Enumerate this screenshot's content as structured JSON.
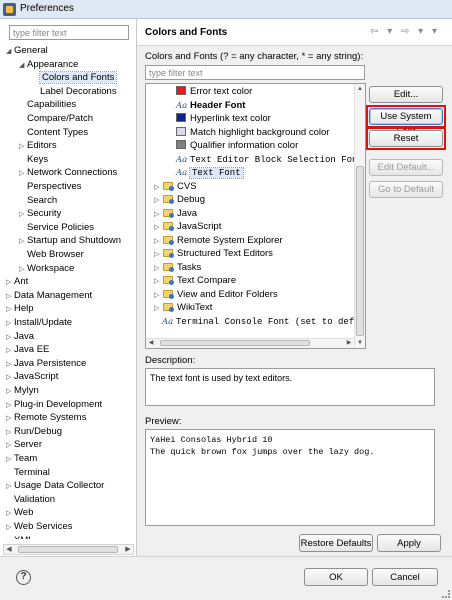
{
  "window": {
    "title": "Preferences"
  },
  "left": {
    "filter_placeholder": "type filter text",
    "tree": [
      {
        "label": "General",
        "indent": 1,
        "twist": "◢"
      },
      {
        "label": "Appearance",
        "indent": 2,
        "twist": "◢"
      },
      {
        "label": "Colors and Fonts",
        "indent": 3,
        "twist": "",
        "selected": true
      },
      {
        "label": "Label Decorations",
        "indent": 3,
        "twist": ""
      },
      {
        "label": "Capabilities",
        "indent": 2,
        "twist": ""
      },
      {
        "label": "Compare/Patch",
        "indent": 2,
        "twist": ""
      },
      {
        "label": "Content Types",
        "indent": 2,
        "twist": ""
      },
      {
        "label": "Editors",
        "indent": 2,
        "twist": "▷"
      },
      {
        "label": "Keys",
        "indent": 2,
        "twist": ""
      },
      {
        "label": "Network Connections",
        "indent": 2,
        "twist": "▷"
      },
      {
        "label": "Perspectives",
        "indent": 2,
        "twist": ""
      },
      {
        "label": "Search",
        "indent": 2,
        "twist": ""
      },
      {
        "label": "Security",
        "indent": 2,
        "twist": "▷"
      },
      {
        "label": "Service Policies",
        "indent": 2,
        "twist": ""
      },
      {
        "label": "Startup and Shutdown",
        "indent": 2,
        "twist": "▷"
      },
      {
        "label": "Web Browser",
        "indent": 2,
        "twist": ""
      },
      {
        "label": "Workspace",
        "indent": 2,
        "twist": "▷"
      },
      {
        "label": "Ant",
        "indent": 1,
        "twist": "▷"
      },
      {
        "label": "Data Management",
        "indent": 1,
        "twist": "▷"
      },
      {
        "label": "Help",
        "indent": 1,
        "twist": "▷"
      },
      {
        "label": "Install/Update",
        "indent": 1,
        "twist": "▷"
      },
      {
        "label": "Java",
        "indent": 1,
        "twist": "▷"
      },
      {
        "label": "Java EE",
        "indent": 1,
        "twist": "▷"
      },
      {
        "label": "Java Persistence",
        "indent": 1,
        "twist": "▷"
      },
      {
        "label": "JavaScript",
        "indent": 1,
        "twist": "▷"
      },
      {
        "label": "Mylyn",
        "indent": 1,
        "twist": "▷"
      },
      {
        "label": "Plug-in Development",
        "indent": 1,
        "twist": "▷"
      },
      {
        "label": "Remote Systems",
        "indent": 1,
        "twist": "▷"
      },
      {
        "label": "Run/Debug",
        "indent": 1,
        "twist": "▷"
      },
      {
        "label": "Server",
        "indent": 1,
        "twist": "▷"
      },
      {
        "label": "Team",
        "indent": 1,
        "twist": "▷"
      },
      {
        "label": "Terminal",
        "indent": 1,
        "twist": ""
      },
      {
        "label": "Usage Data Collector",
        "indent": 1,
        "twist": "▷"
      },
      {
        "label": "Validation",
        "indent": 1,
        "twist": ""
      },
      {
        "label": "Web",
        "indent": 1,
        "twist": "▷"
      },
      {
        "label": "Web Services",
        "indent": 1,
        "twist": "▷"
      },
      {
        "label": "XML",
        "indent": 1,
        "twist": "▷"
      }
    ]
  },
  "page": {
    "title": "Colors and Fonts",
    "nav": "⇦ ▾ ⇨ ▾ ▾",
    "subtitle": "Colors and Fonts (? = any character, * = any string):",
    "filter_placeholder": "type filter text",
    "fonts_tree": [
      {
        "label": "Error text color",
        "kind": "color",
        "color": "#e02020",
        "indent": 2
      },
      {
        "label": "Header Font",
        "kind": "font",
        "indent": 2,
        "bold": true
      },
      {
        "label": "Hyperlink text color",
        "kind": "color",
        "color": "#10208c",
        "indent": 2
      },
      {
        "label": "Match highlight background color",
        "kind": "color",
        "color": "#d8d8ee",
        "indent": 2
      },
      {
        "label": "Qualifier information color",
        "kind": "color",
        "color": "#808080",
        "indent": 2
      },
      {
        "label": "Text Editor Block Selection Font",
        "kind": "font",
        "indent": 2,
        "mono": true
      },
      {
        "label": "Text Font",
        "kind": "font",
        "indent": 2,
        "mono": true,
        "selected": true
      },
      {
        "label": "CVS",
        "kind": "folder",
        "indent": 1
      },
      {
        "label": "Debug",
        "kind": "folder",
        "indent": 1
      },
      {
        "label": "Java",
        "kind": "folder",
        "indent": 1
      },
      {
        "label": "JavaScript",
        "kind": "folder",
        "indent": 1
      },
      {
        "label": "Remote System Explorer",
        "kind": "folder",
        "indent": 1
      },
      {
        "label": "Structured Text Editors",
        "kind": "folder",
        "indent": 1
      },
      {
        "label": "Tasks",
        "kind": "folder",
        "indent": 1
      },
      {
        "label": "Text Compare",
        "kind": "folder",
        "indent": 1
      },
      {
        "label": "View and Editor Folders",
        "kind": "folder",
        "indent": 1
      },
      {
        "label": "WikiText",
        "kind": "folder",
        "indent": 1
      },
      {
        "label": "Terminal Console Font (set to defau",
        "kind": "font",
        "indent": 1,
        "mono": true
      }
    ],
    "buttons": {
      "edit": "Edit...",
      "use_system_font": "Use System Font",
      "reset": "Reset",
      "edit_default": "Edit Default...",
      "go_to_default": "Go to Default"
    },
    "description_label": "Description:",
    "description_text": "The text font is used by text editors.",
    "preview_label": "Preview:",
    "preview_lines": [
      "YaHei Consolas Hybrid 10",
      "The quick brown fox jumps over the lazy dog."
    ],
    "restore_defaults": "Restore Defaults",
    "apply": "Apply"
  },
  "footer": {
    "help": "?",
    "ok": "OK",
    "cancel": "Cancel"
  }
}
